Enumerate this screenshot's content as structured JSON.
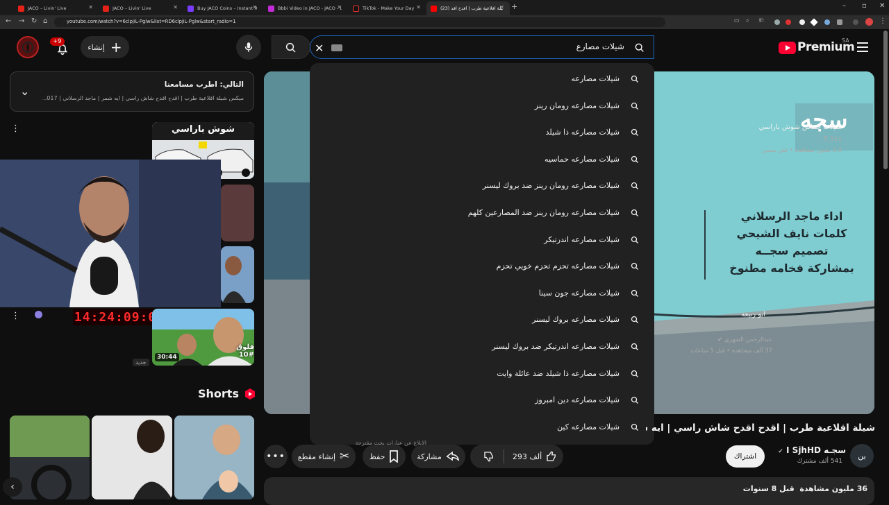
{
  "tabs": [
    {
      "label": "JACO – Livin' Live",
      "color": "#e62117"
    },
    {
      "label": "JACO – Livin' Live",
      "color": "#e62117"
    },
    {
      "label": "Buy JACO Coins – Instant Recha…",
      "color": "#7a3cff"
    },
    {
      "label": "Bbbi Video in JACO - JACO - Liv…",
      "color": "#c42bd8"
    },
    {
      "label": "TikTok - Make Your Day",
      "color": "#111111"
    },
    {
      "label": "(23) شيلة اقلاعية طرب | اقدح اقد…",
      "color": "#ff0000"
    }
  ],
  "address": {
    "url": "youtube.com/watch?v=6clpjiL-Pglw&list=RD6clpjiL-Pglw&start_radio=1"
  },
  "header": {
    "brand": "Premium",
    "region": "SA",
    "search_value": "شيلات مصارع",
    "create_label": "إنشاء",
    "notif_count": "+9"
  },
  "suggestions": [
    "شيلات مصارعه",
    "شيلات مصارعه رومان رينز",
    "شيلات مصارعه ذا شيلد",
    "شيلات مصارعه حماسيه",
    "شيلات مصارعه رومان رينز ضد بروك ليسنر",
    "شيلات مصارعه رومان رينز ضد المصارعين كلهم",
    "شيلات مصارعه اندرتيكر",
    "شيلات مصارعه تحزم تحزم خويي تحزم",
    "شيلات مصارعه جون سينا",
    "شيلات مصارعه بروك ليسنر",
    "شيلات مصارعه اندرتيكر ضد بروك ليسنر",
    "شيلات مصارعه ذا شيلد ضد عائلة وايت",
    "شيلات مصارعه دين امبروز",
    "شيلات مصارعه كين"
  ],
  "dropdown_footer": "الإبلاغ عن عبارات بحث مقترحة",
  "next_box": {
    "title": "التالي: اطرب مسامعنا",
    "subtitle": "ميكس شيلة اقلاعية طرب | اقدح اقدح شاش راسي | ايه شمر | ماجد الرسلاني | 017..."
  },
  "sidebar_videos": [
    {
      "title": "شيلات حماس شوش باراسي",
      "channel": "ff_511",
      "meta": "3.3 مليون مشاهدة • قبل سنتين",
      "thumb_text": "شوش باراسي"
    },
    {
      "title": "ابو ربيعه",
      "channel": "عبدالرحمن الشهري",
      "meta": "37 ألف مشاهدة • قبل 5 ساعات",
      "badge": "جديد",
      "duration": "30:44",
      "thumb_text": "فلوق #10"
    }
  ],
  "overlay_clock": "14:24:09:03",
  "shorts_label": "Shorts",
  "video": {
    "title": "شيلة اقلاعية طرب | اقدح اقدح شاش راسي | ايه شمر |",
    "channel": "سجـه I SjhHD",
    "subscribers": "541 ألف مشترك",
    "subscribe_label": "اشتراك",
    "likes": "293 ألف",
    "share_label": "مشاركة",
    "save_label": "حفظ",
    "clip_label": "إنشاء مقطع",
    "views": "36 مليون مشاهدة",
    "age": "قبل 8 سنوات",
    "logo_text": "سجه",
    "poster_lines": [
      "اداء ماجد الرسلاني",
      "كلمات نايف الشيحي",
      "تصميم سجــه",
      "بمشاركة فخامه مطنوخ"
    ]
  },
  "colors": {
    "accent": "#1c62b9",
    "brand_red": "#ff0033",
    "bg": "#0f0f0f"
  }
}
